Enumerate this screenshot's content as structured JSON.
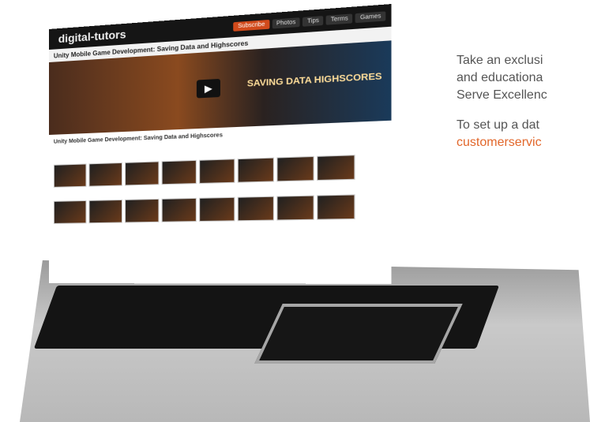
{
  "laptop": {
    "website": {
      "brand": "digital-tutors",
      "nav_tabs": [
        {
          "label": "Subscribe"
        },
        {
          "label": "Photos"
        },
        {
          "label": "Tips"
        },
        {
          "label": "Terms"
        },
        {
          "label": "Games"
        }
      ],
      "course_title": "Unity Mobile Game Development: Saving Data and Highscores",
      "hero_stamp": "SAVING DATA\nHIGHSCORES",
      "panel_title": "Unity Mobile Game Development: Saving Data and Highscores",
      "panel_desc": "",
      "lessons": [
        {
          "caption": ""
        },
        {
          "caption": ""
        },
        {
          "caption": ""
        },
        {
          "caption": ""
        },
        {
          "caption": ""
        },
        {
          "caption": ""
        },
        {
          "caption": ""
        },
        {
          "caption": ""
        },
        {
          "caption": ""
        },
        {
          "caption": ""
        },
        {
          "caption": ""
        },
        {
          "caption": ""
        },
        {
          "caption": ""
        },
        {
          "caption": ""
        },
        {
          "caption": ""
        },
        {
          "caption": ""
        }
      ]
    }
  },
  "right_text": {
    "line1": "Take an exclusi",
    "line2": "and educationa",
    "line3": "Serve Excellenc",
    "line4": "To set up a dat",
    "email": "customerservic"
  },
  "colors": {
    "email": "#e2672b"
  }
}
